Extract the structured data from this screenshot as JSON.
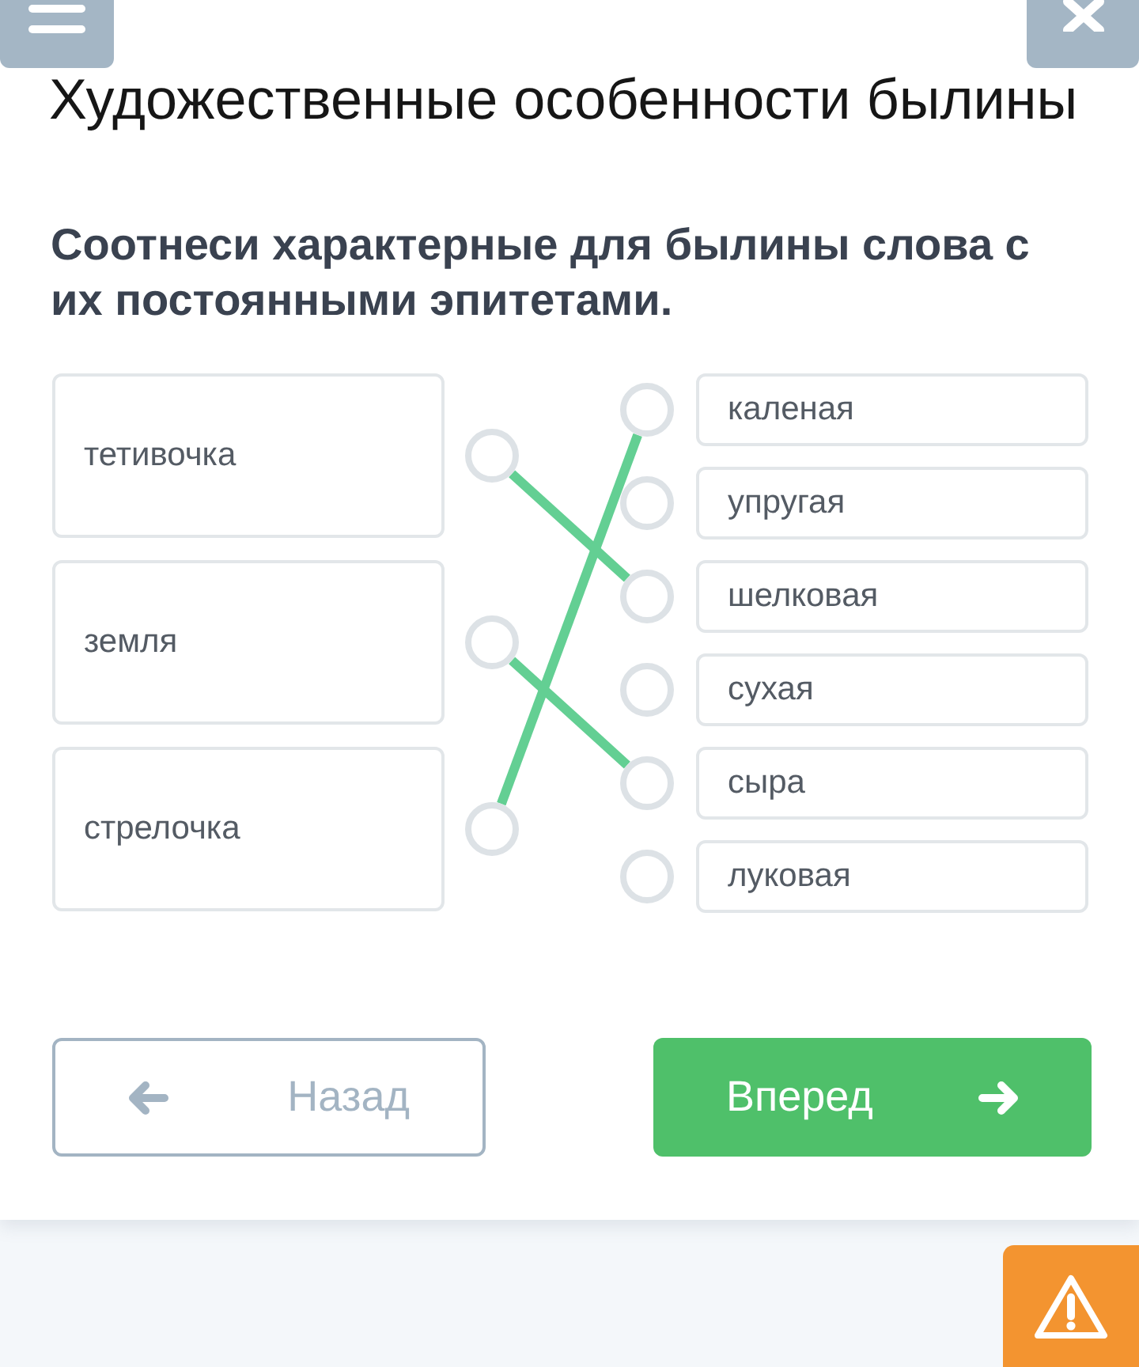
{
  "title": "Художественные особенности былины",
  "question": "Соотнеси характерные для былины слова с их постоянными эпитетами.",
  "matching": {
    "left": [
      {
        "label": "тетивочка",
        "linked": [
          false,
          false,
          true,
          false,
          false,
          false
        ]
      },
      {
        "label": "земля",
        "linked": [
          false,
          false,
          false,
          false,
          true,
          false
        ]
      },
      {
        "label": "стрелочка",
        "linked": [
          true,
          false,
          false,
          false,
          false,
          false
        ]
      }
    ],
    "right": [
      "каленая",
      "упругая",
      "шелковая",
      "сухая",
      "сыра",
      "луковая"
    ]
  },
  "buttons": [
    {
      "label": "Назад",
      "kind": "back"
    },
    {
      "label": "Вперед",
      "kind": "next"
    }
  ]
}
